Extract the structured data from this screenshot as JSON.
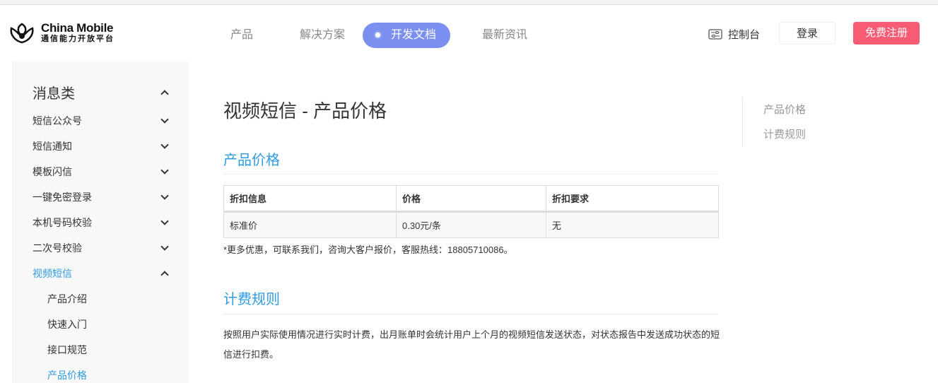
{
  "header": {
    "logo": {
      "en": "China Mobile",
      "cn": "通信能力开放平台"
    },
    "nav": [
      {
        "label": "产品"
      },
      {
        "label": "解决方案"
      },
      {
        "label": "开发文档",
        "active": true
      },
      {
        "label": "最新资讯"
      }
    ],
    "console_label": "控制台",
    "login_label": "登录",
    "register_label": "免费注册",
    "accent": "#7a8ff0",
    "register_color": "#f75c74"
  },
  "sidebar": {
    "category": "消息类",
    "items": [
      {
        "label": "短信公众号"
      },
      {
        "label": "短信通知"
      },
      {
        "label": "模板闪信"
      },
      {
        "label": "一键免密登录"
      },
      {
        "label": "本机号码校验"
      },
      {
        "label": "二次号校验"
      },
      {
        "label": "视频短信",
        "expanded": true
      }
    ],
    "subitems": [
      {
        "label": "产品介绍"
      },
      {
        "label": "快速入门"
      },
      {
        "label": "接口规范"
      },
      {
        "label": "产品价格",
        "active": true
      }
    ]
  },
  "main": {
    "title": "视频短信 - 产品价格",
    "section1": "产品价格",
    "table": {
      "headers": [
        "折扣信息",
        "价格",
        "折扣要求"
      ],
      "rows": [
        [
          "标准价",
          "0.30元/条",
          "无"
        ]
      ]
    },
    "note": "*更多优惠，可联系我们，咨询大客户报价，客服热线：18805710086。",
    "section2": "计费规则",
    "paragraph": "按照用户实际使用情况进行实时计费，出月账单时会统计用户上个月的视频短信发送状态，对状态报告中发送成功状态的短信进行扣费。"
  },
  "toc": [
    "产品价格",
    "计费规则"
  ]
}
